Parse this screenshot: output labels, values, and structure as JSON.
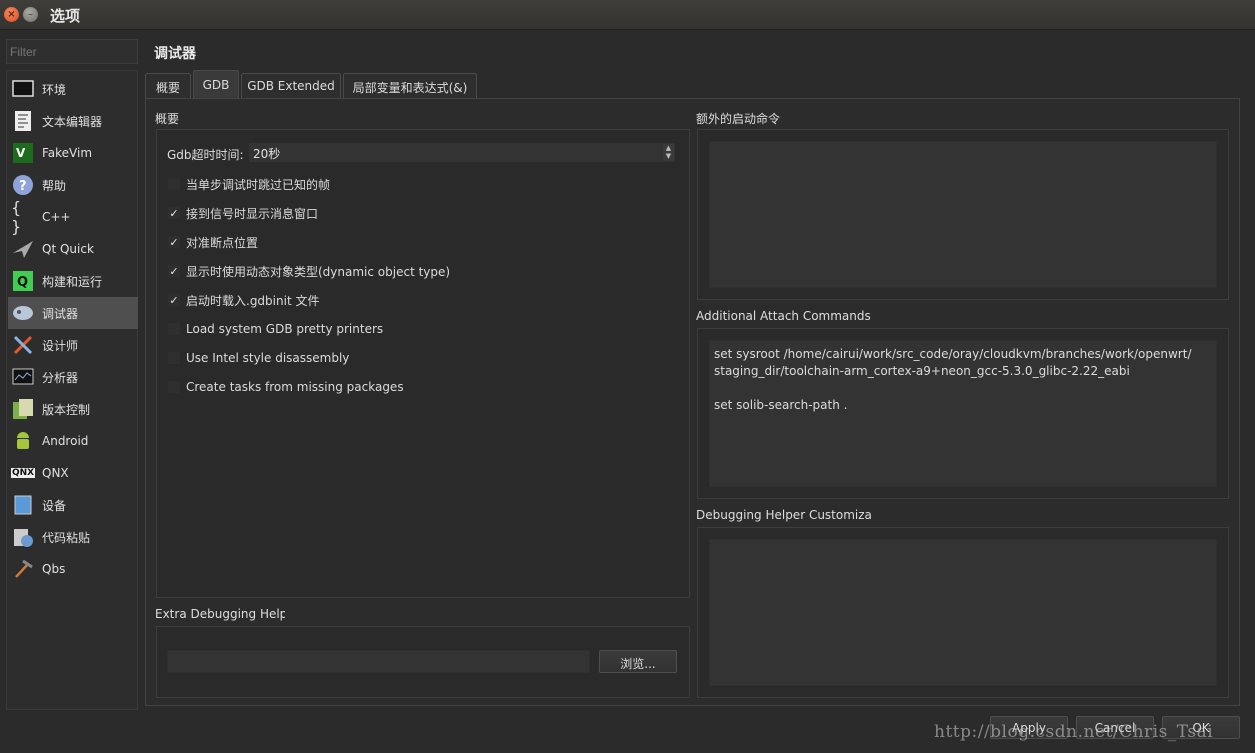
{
  "window": {
    "title": "选项",
    "close_glyph": "×",
    "min_glyph": "–"
  },
  "sidebar": {
    "filter_placeholder": "Filter",
    "items": [
      {
        "label": "环境",
        "icon": "monitor-icon"
      },
      {
        "label": "文本编辑器",
        "icon": "text-editor-icon"
      },
      {
        "label": "FakeVim",
        "icon": "fakevim-icon"
      },
      {
        "label": "帮助",
        "icon": "help-icon"
      },
      {
        "label": "C++",
        "icon": "braces-icon"
      },
      {
        "label": "Qt Quick",
        "icon": "qt-quick-icon"
      },
      {
        "label": "构建和运行",
        "icon": "build-run-icon"
      },
      {
        "label": "调试器",
        "icon": "debugger-icon",
        "selected": true
      },
      {
        "label": "设计师",
        "icon": "designer-icon"
      },
      {
        "label": "分析器",
        "icon": "analyzer-icon"
      },
      {
        "label": "版本控制",
        "icon": "version-control-icon"
      },
      {
        "label": "Android",
        "icon": "android-icon"
      },
      {
        "label": "QNX",
        "icon": "qnx-icon"
      },
      {
        "label": "设备",
        "icon": "device-icon"
      },
      {
        "label": "代码粘贴",
        "icon": "code-paste-icon"
      },
      {
        "label": "Qbs",
        "icon": "qbs-icon"
      }
    ]
  },
  "page": {
    "title": "调试器"
  },
  "tabs": [
    {
      "label": "概要"
    },
    {
      "label": "GDB",
      "active": true
    },
    {
      "label": "GDB Extended"
    },
    {
      "label": "局部变量和表达式(&)"
    }
  ],
  "general": {
    "title": "概要",
    "timeout_label": "Gdb超时时间:",
    "timeout_value": "20秒",
    "checkboxes": [
      {
        "label": "当单步调试时跳过已知的帧",
        "checked": false
      },
      {
        "label": "接到信号时显示消息窗口",
        "checked": true
      },
      {
        "label": "对准断点位置",
        "checked": true
      },
      {
        "label": "显示时使用动态对象类型(dynamic object type)",
        "checked": true
      },
      {
        "label": "启动时载入.gdbinit 文件",
        "checked": true
      },
      {
        "label": "Load system GDB pretty printers",
        "checked": false
      },
      {
        "label": "Use Intel style disassembly",
        "checked": false
      },
      {
        "label": "Create tasks from missing packages",
        "checked": false
      }
    ],
    "check_glyph": "✓"
  },
  "extra_helpers": {
    "title": "Extra Debugging Helpers",
    "browse_label": "浏览..."
  },
  "startup_commands": {
    "title": "额外的启动命令",
    "value": ""
  },
  "attach_commands": {
    "title": "Additional Attach Commands",
    "value": "set sysroot /home/cairui/work/src_code/oray/cloudkvm/branches/work/openwrt/\nstaging_dir/toolchain-arm_cortex-a9+neon_gcc-5.3.0_glibc-2.22_eabi\n\nset solib-search-path ."
  },
  "helper_custom": {
    "title": "Debugging Helper Customization",
    "value": ""
  },
  "footer": {
    "apply_label": "Apply",
    "cancel_label": "Cancel",
    "ok_label": "OK"
  },
  "watermark": "http://blog.csdn.net/Chris_Tsai"
}
